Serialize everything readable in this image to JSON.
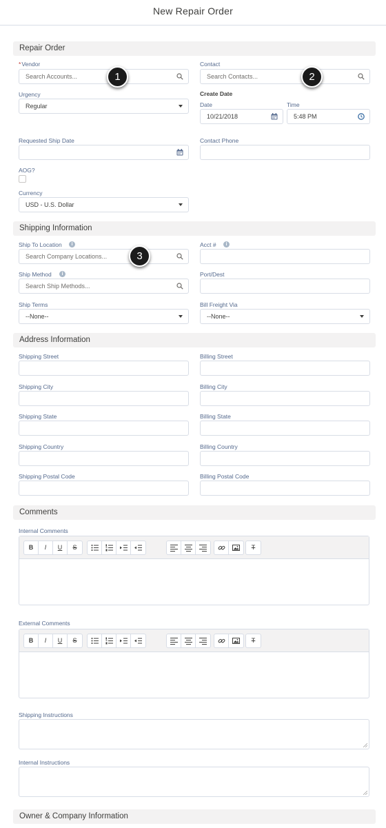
{
  "header": {
    "title": "New Repair Order"
  },
  "sections": {
    "repair_order": "Repair Order",
    "shipping": "Shipping Information",
    "address": "Address Information",
    "comments": "Comments",
    "owner": "Owner & Company Information"
  },
  "repair_order": {
    "vendor_required": "*",
    "vendor_label": "Vendor",
    "vendor_placeholder": "Search Accounts...",
    "contact_label": "Contact",
    "contact_placeholder": "Search Contacts...",
    "urgency_label": "Urgency",
    "urgency_value": "Regular",
    "create_date_label": "Create Date",
    "date_label": "Date",
    "date_value": "10/21/2018",
    "time_label": "Time",
    "time_value": "5:48 PM",
    "requested_ship_date_label": "Requested Ship Date",
    "contact_phone_label": "Contact Phone",
    "aog_label": "AOG?",
    "currency_label": "Currency",
    "currency_value": "USD - U.S. Dollar"
  },
  "shipping": {
    "ship_to_location_label": "Ship To Location",
    "ship_to_location_placeholder": "Search Company Locations...",
    "acct_label": "Acct #",
    "ship_method_label": "Ship Method",
    "ship_method_placeholder": "Search Ship Methods...",
    "port_dest_label": "Port/Dest",
    "ship_terms_label": "Ship Terms",
    "ship_terms_value": "--None--",
    "bill_freight_via_label": "Bill Freight Via",
    "bill_freight_via_value": "--None--"
  },
  "address": {
    "shipping_street": "Shipping Street",
    "billing_street": "Billing Street",
    "shipping_city": "Shipping City",
    "billing_city": "Billing City",
    "shipping_state": "Shipping State",
    "billing_state": "Billing State",
    "shipping_country": "Shipping Country",
    "billing_country": "Billing Country",
    "shipping_postal_code": "Shipping Postal Code",
    "billing_postal_code": "Billing Postal Code"
  },
  "comments": {
    "internal_comments_label": "Internal Comments",
    "external_comments_label": "External Comments",
    "shipping_instructions_label": "Shipping Instructions",
    "internal_instructions_label": "Internal Instructions"
  },
  "toolbar": {
    "bold": "B",
    "italic": "I",
    "underline": "U",
    "strike": "S",
    "clear": "T"
  },
  "callouts": {
    "one": "1",
    "two": "2",
    "three": "3"
  },
  "icons": {
    "search": "search-icon",
    "calendar": "calendar-icon",
    "clock": "clock-icon",
    "info": "info-icon",
    "dropdown": "chevron-down-icon"
  },
  "colors": {
    "section_bg": "#f3f2f2",
    "border": "#d8dde6",
    "label": "#54698d",
    "required": "#c23934",
    "icon_blue": "#54698d"
  }
}
